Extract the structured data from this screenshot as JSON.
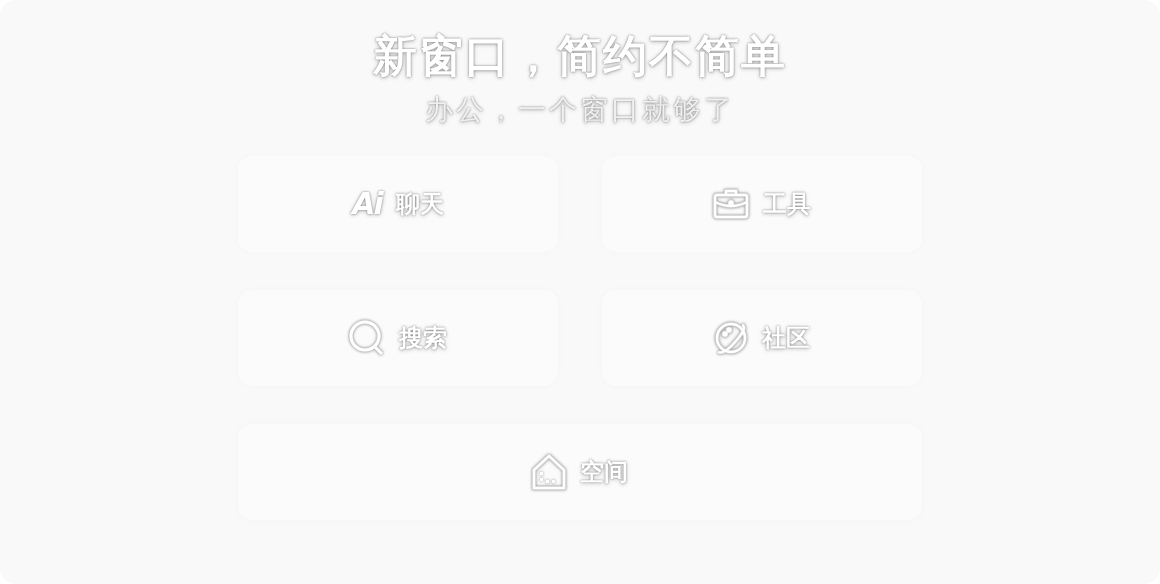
{
  "title": "新窗口，简约不简单",
  "subtitle": "办公，一个窗口就够了",
  "tiles": [
    {
      "kind": "ai",
      "logo_text": "Ai",
      "label": "聊天"
    },
    {
      "kind": "toolbox",
      "label": "工具"
    },
    {
      "kind": "search",
      "label": "搜索"
    },
    {
      "kind": "planet",
      "label": "社区"
    },
    {
      "kind": "house",
      "label": "空间"
    }
  ]
}
